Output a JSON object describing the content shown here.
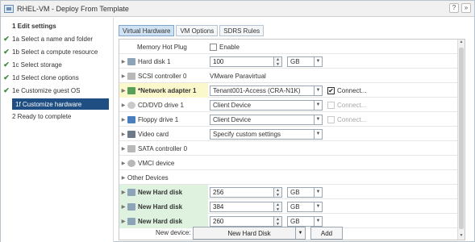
{
  "window": {
    "title": "RHEL-VM - Deploy From Template"
  },
  "sidebar": {
    "steps": [
      {
        "label": "1  Edit settings",
        "done": false
      },
      {
        "label": "1a Select a name and folder",
        "done": true
      },
      {
        "label": "1b Select a compute resource",
        "done": true
      },
      {
        "label": "1c Select storage",
        "done": true
      },
      {
        "label": "1d Select clone options",
        "done": true
      },
      {
        "label": "1e Customize guest OS",
        "done": true
      },
      {
        "label": "1f Customize hardware",
        "done": false,
        "active": true
      },
      {
        "label": "2  Ready to complete",
        "done": false
      }
    ]
  },
  "tabs": [
    "Virtual Hardware",
    "VM Options",
    "SDRS Rules"
  ],
  "hardware": {
    "memory_hot_plug": {
      "label": "Memory Hot Plug",
      "checkbox_label": "Enable"
    },
    "hard_disk_1": {
      "label": "Hard disk 1",
      "size": "100",
      "unit": "GB"
    },
    "scsi": {
      "label": "SCSI controller 0",
      "value": "VMware Paravirtual"
    },
    "net": {
      "label": "*Network adapter 1",
      "network": "Tenant001-Access (CRA-N1K)",
      "connect": "Connect..."
    },
    "cd": {
      "label": "CD/DVD drive 1",
      "value": "Client Device",
      "connect": "Connect..."
    },
    "floppy": {
      "label": "Floppy drive 1",
      "value": "Client Device",
      "connect": "Connect..."
    },
    "video": {
      "label": "Video card",
      "value": "Specify custom settings"
    },
    "sata": {
      "label": "SATA controller 0"
    },
    "vmci": {
      "label": "VMCI device"
    },
    "other": {
      "label": "Other Devices"
    },
    "new_disks": [
      {
        "label": "New Hard disk",
        "size": "256",
        "unit": "GB"
      },
      {
        "label": "New Hard disk",
        "size": "384",
        "unit": "GB"
      },
      {
        "label": "New Hard disk",
        "size": "260",
        "unit": "GB"
      }
    ]
  },
  "footer": {
    "new_device_label": "New device:",
    "new_device_value": "New Hard Disk",
    "add_label": "Add"
  }
}
